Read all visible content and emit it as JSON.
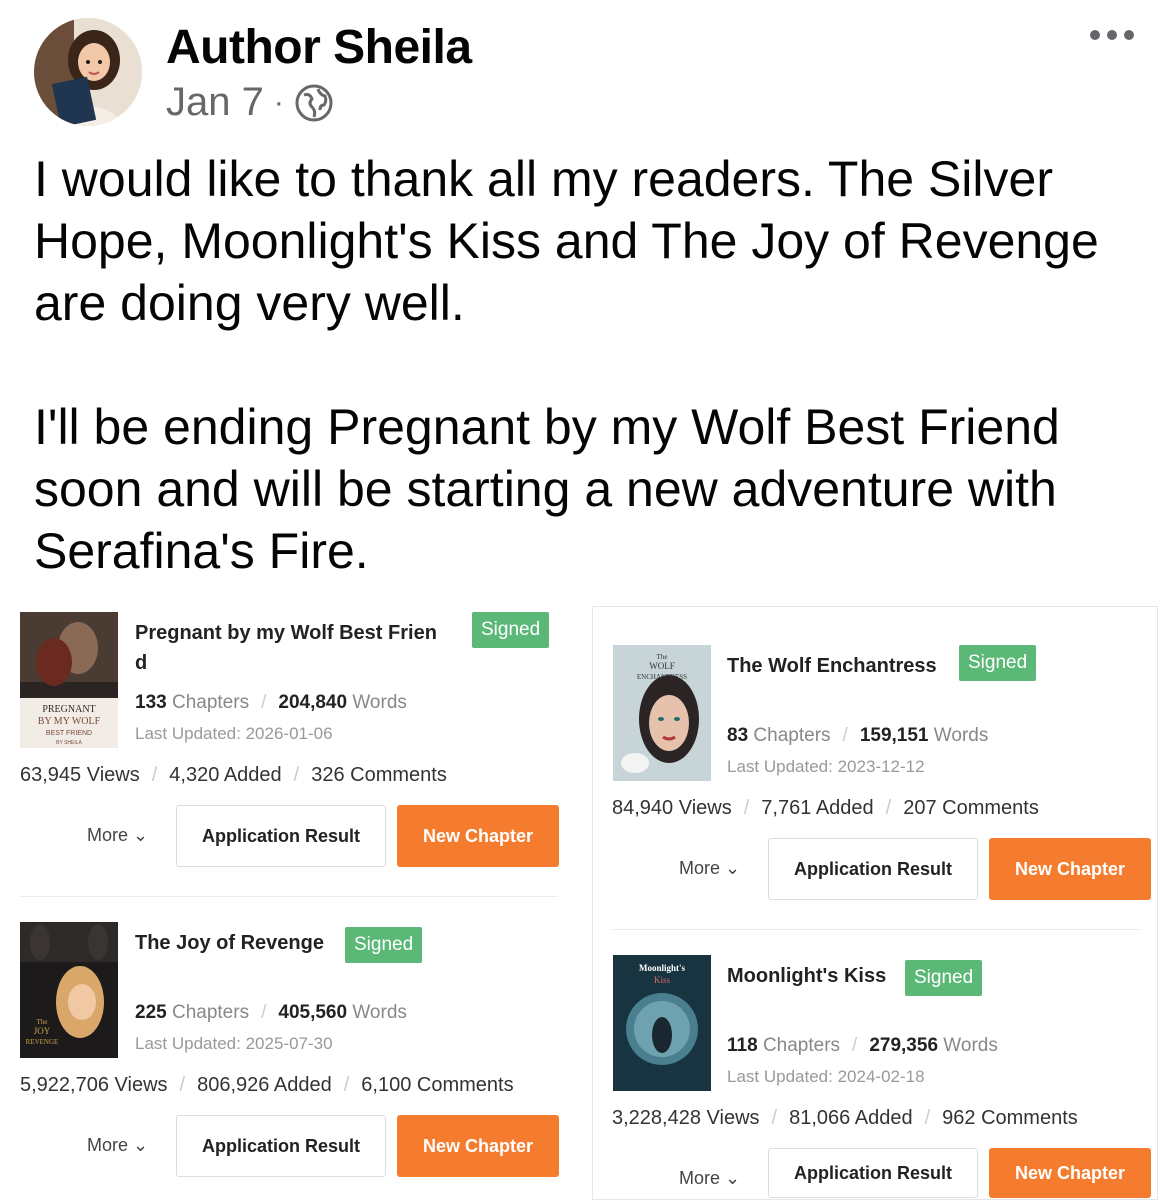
{
  "header": {
    "author": "Author Sheila",
    "date": "Jan 7",
    "separator": "·",
    "privacy_icon": "globe-icon",
    "menu_icon": "more-horizontal-icon"
  },
  "post": {
    "paragraph1": "I would like to thank all my readers. The Silver Hope, Moonlight's Kiss and The Joy of Revenge are doing very well.",
    "paragraph2": "I'll be ending Pregnant by my Wolf Best Friend soon and will be starting a new adventure with Serafina's Fire."
  },
  "labels": {
    "chapters": "Chapters",
    "words": "Words",
    "views": "Views",
    "added": "Added",
    "comments": "Comments",
    "last_updated": "Last Updated:",
    "more": "More",
    "application_result": "Application Result",
    "new_chapter": "New Chapter",
    "signed": "Signed"
  },
  "books": [
    {
      "title_line1": "Pregnant by my Wolf Best Frien",
      "title_line2": "d",
      "cover_text": [
        "PREGNANT",
        "BY MY WOLF",
        "BEST FRIEND",
        "BY SHEILA"
      ],
      "chapters": "133",
      "words": "204,840",
      "last_updated": "2026-01-06",
      "views": "63,945",
      "added": "4,320",
      "comments": "326"
    },
    {
      "title_line1": "The Joy of Revenge",
      "cover_text": [
        "The",
        "JOY",
        "REVENGE"
      ],
      "chapters": "225",
      "words": "405,560",
      "last_updated": "2025-07-30",
      "views": "5,922,706",
      "added": "806,926",
      "comments": "6,100"
    },
    {
      "title_line1": "The Wolf Enchantress",
      "cover_text": [
        "The",
        "WOLF",
        "ENCHANTRESS"
      ],
      "chapters": "83",
      "words": "159,151",
      "last_updated": "2023-12-12",
      "views": "84,940",
      "added": "7,761",
      "comments": "207"
    },
    {
      "title_line1": "Moonlight's Kiss",
      "cover_text": [
        "Moonlight's",
        "Kiss"
      ],
      "chapters": "118",
      "words": "279,356",
      "last_updated": "2024-02-18",
      "views": "3,228,428",
      "added": "81,066",
      "comments": "962"
    }
  ],
  "colors": {
    "signed_green": "#5cb877",
    "new_chapter_orange": "#f57c2e",
    "meta_gray": "#65676b"
  }
}
